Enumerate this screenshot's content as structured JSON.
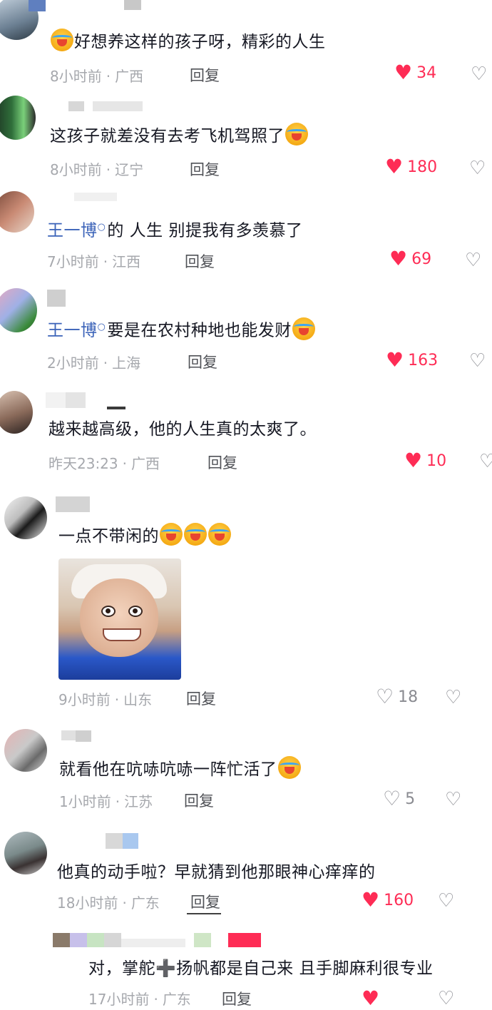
{
  "comments": [
    {
      "text": "好想养这样的孩子呀，精彩的人生",
      "time": "8小时前",
      "location": "广西",
      "reply": "回复",
      "likes": "34",
      "liked": true
    },
    {
      "text": "这孩子就差没有去考飞机驾照了",
      "time": "8小时前",
      "location": "辽宁",
      "reply": "回复",
      "likes": "180",
      "liked": true
    },
    {
      "mention": "王一博",
      "text": "的 人生 别提我有多羡慕了",
      "time": "7小时前",
      "location": "江西",
      "reply": "回复",
      "likes": "69",
      "liked": true
    },
    {
      "mention": "王一博",
      "text": "要是在农村种地也能发财",
      "time": "2小时前",
      "location": "上海",
      "reply": "回复",
      "likes": "163",
      "liked": true
    },
    {
      "text": "越来越高级，他的人生真的太爽了。",
      "time": "昨天23:23",
      "location": "广西",
      "reply": "回复",
      "likes": "10",
      "liked": true
    },
    {
      "text": "一点不带闲的",
      "time": "9小时前",
      "location": "山东",
      "reply": "回复",
      "likes": "18",
      "liked": false
    },
    {
      "text": "就看他在吭哧吭哧一阵忙活了",
      "time": "1小时前",
      "location": "江苏",
      "reply": "回复",
      "likes": "5",
      "liked": false
    },
    {
      "text": "他真的动手啦？早就猜到他那眼神心痒痒的",
      "time": "18小时前",
      "location": "广东",
      "reply": "回复",
      "likes": "160",
      "liked": true
    },
    {
      "text_a": "对，掌舵",
      "plus": "➕",
      "text_b": "扬帆都是自己来 且手脚麻利很专业",
      "time": "17小时前",
      "location": "广东",
      "reply": "回复"
    }
  ],
  "icons": {
    "heart_filled": "heart-filled-icon",
    "heart_outline": "heart-outline-icon",
    "dislike": "broken-heart-icon",
    "emoji": "loudly-crying-face-emoji"
  },
  "colors": {
    "like_active": "#fe2c55",
    "mention": "#3a62b8",
    "meta": "#a6a8ad"
  }
}
